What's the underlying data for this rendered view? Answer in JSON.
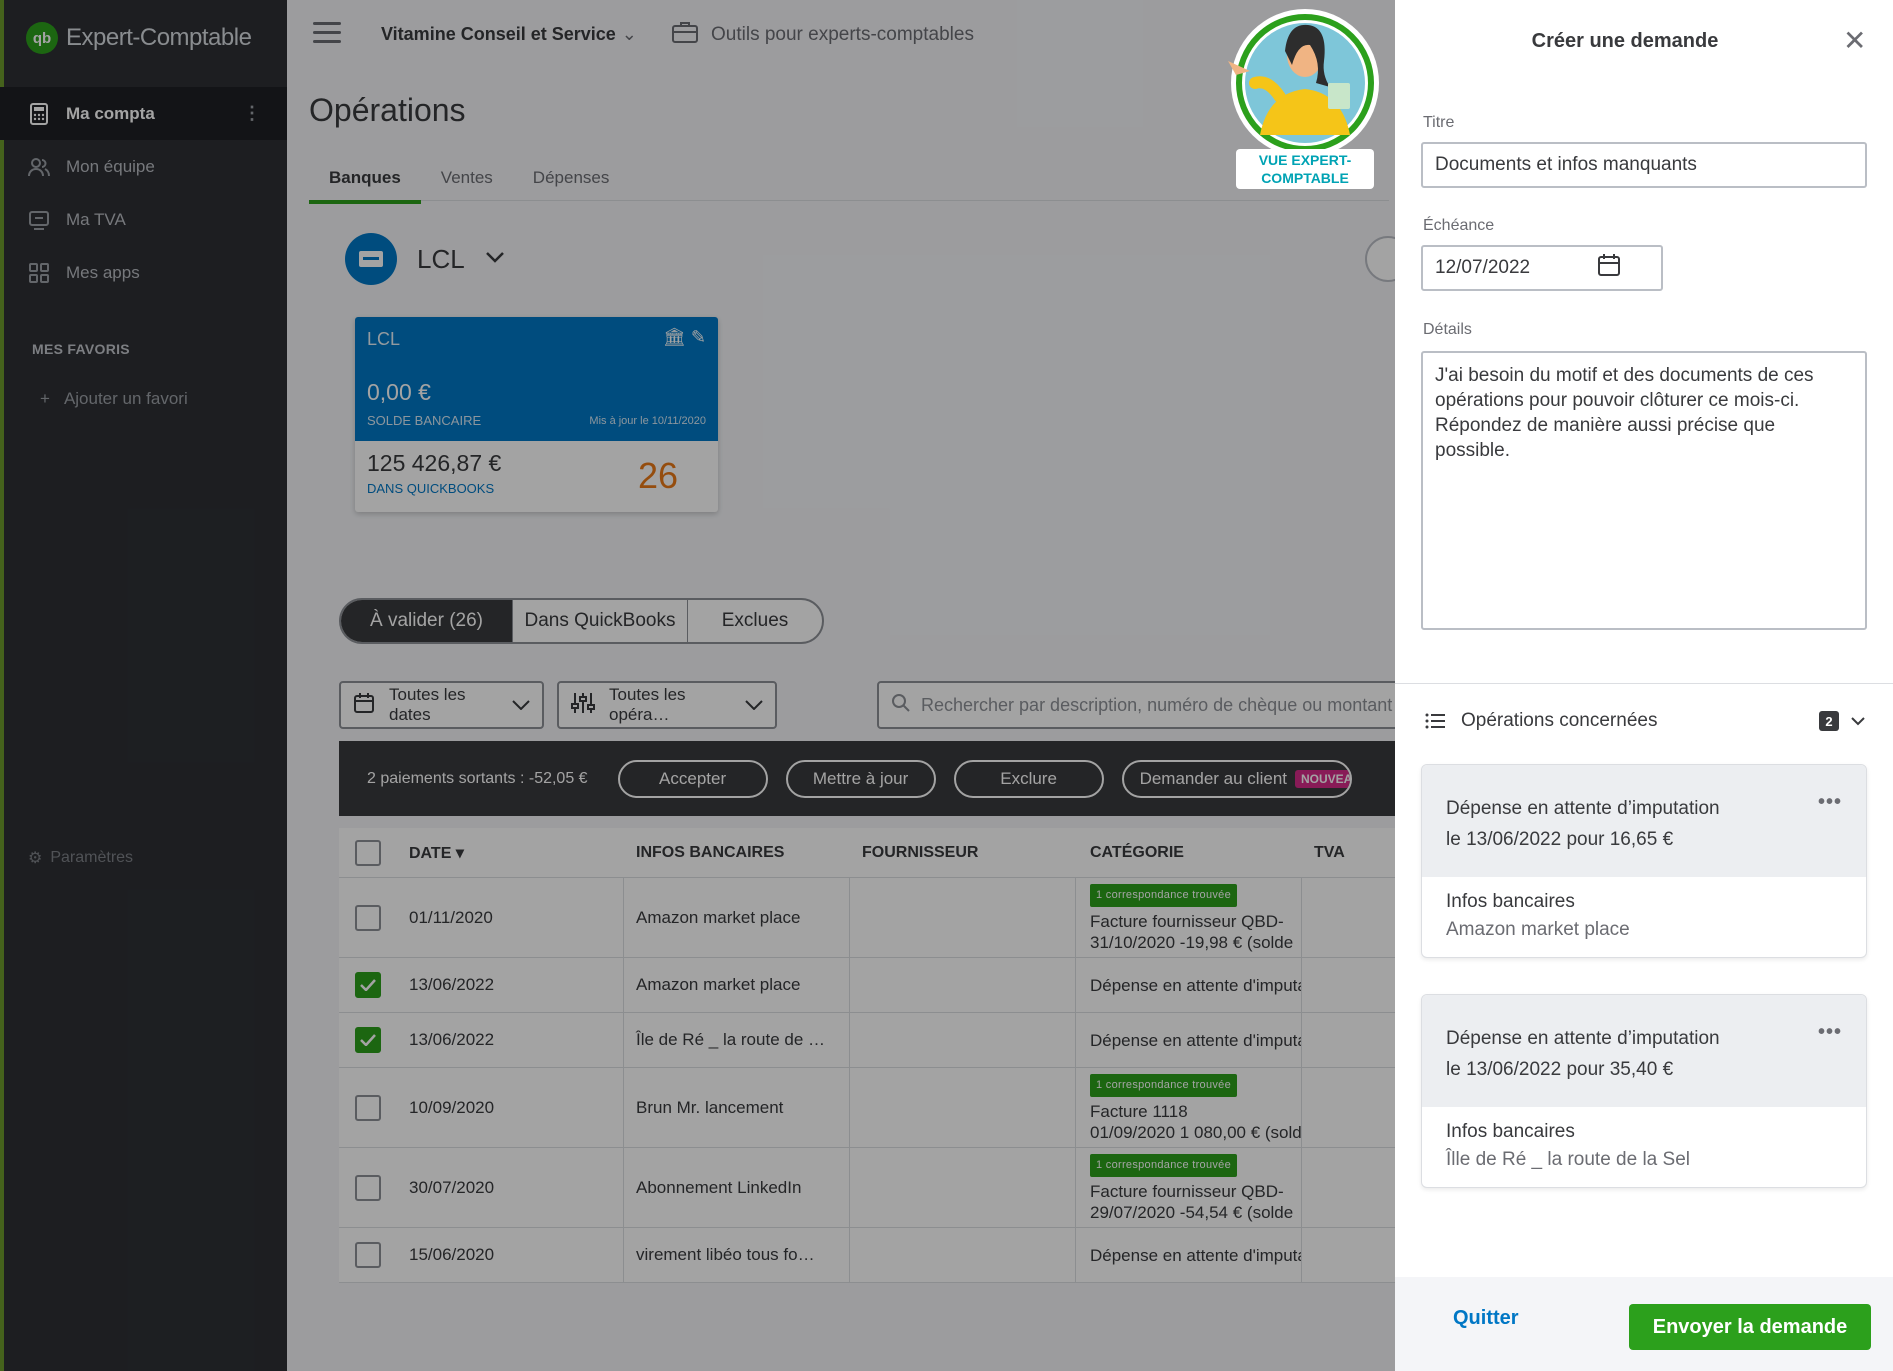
{
  "app": {
    "brand": "Expert-Comptable",
    "logo": "qb"
  },
  "sidebar": {
    "items": [
      {
        "label": "Ma compta",
        "icon": "calculator-icon"
      },
      {
        "label": "Mon équipe",
        "icon": "team-icon"
      },
      {
        "label": "Ma TVA",
        "icon": "tax-icon"
      },
      {
        "label": "Mes apps",
        "icon": "apps-icon"
      }
    ],
    "favorites_title": "MES FAVORIS",
    "add_favorite": "Ajouter un favori",
    "settings": "Paramètres"
  },
  "topbar": {
    "company": "Vitamine Conseil et Service",
    "tools": "Outils pour experts-comptables"
  },
  "page": {
    "title": "Opérations",
    "tabs": [
      "Banques",
      "Ventes",
      "Dépenses"
    ]
  },
  "bank": {
    "selected": "LCL",
    "card": {
      "name": "LCL",
      "balance": "0,00 €",
      "balance_label": "SOLDE BANCAIRE",
      "updated": "Mis à jour le 10/11/2020",
      "qb_balance": "125 426,87 €",
      "qb_label": "DANS QUICKBOOKS",
      "pending": "26"
    }
  },
  "segments": [
    "À valider (26)",
    "Dans QuickBooks",
    "Exclues"
  ],
  "filters": {
    "dates": "Toutes les dates",
    "operations": "Toutes les opéra…",
    "search_placeholder": "Rechercher par description, numéro de chèque ou montant"
  },
  "bulk": {
    "summary": "2 paiements sortants : -52,05 €",
    "accept": "Accepter",
    "update": "Mettre à jour",
    "exclude": "Exclure",
    "ask_client": "Demander au client",
    "new_badge": "NOUVEAU"
  },
  "table": {
    "headers": [
      "DATE",
      "INFOS BANCAIRES",
      "FOURNISSEUR",
      "CATÉGORIE",
      "TVA"
    ],
    "rows": [
      {
        "checked": false,
        "date": "01/11/2020",
        "bank": "Amazon market place",
        "match": "1 correspondance trouvée",
        "cat1": "Facture fournisseur QBD-",
        "cat2": "31/10/2020 -19,98 € (solde"
      },
      {
        "checked": true,
        "date": "13/06/2022",
        "bank": "Amazon market place",
        "match": "",
        "cat1": "Dépense en attente d'imputation",
        "cat2": ""
      },
      {
        "checked": true,
        "date": "13/06/2022",
        "bank": "Île de Ré _ la route de …",
        "match": "",
        "cat1": "Dépense en attente d'imputation",
        "cat2": ""
      },
      {
        "checked": false,
        "date": "10/09/2020",
        "bank": "Brun Mr. lancement",
        "match": "1 correspondance trouvée",
        "cat1": "Facture 1118",
        "cat2": "01/09/2020 1 080,00 € (solde"
      },
      {
        "checked": false,
        "date": "30/07/2020",
        "bank": "Abonnement LinkedIn",
        "match": "1 correspondance trouvée",
        "cat1": "Facture fournisseur QBD-",
        "cat2": "29/07/2020 -54,54 € (solde"
      },
      {
        "checked": false,
        "date": "15/06/2020",
        "bank": "virement libéo tous fo…",
        "match": "",
        "cat1": "Dépense en attente d'imputation",
        "cat2": ""
      }
    ]
  },
  "badge": {
    "line1": "VUE EXPERT-",
    "line2": "COMPTABLE"
  },
  "panel": {
    "title": "Créer une demande",
    "title_label": "Titre",
    "title_value": "Documents et infos manquants",
    "due_label": "Échéance",
    "due_value": "12/07/2022",
    "details_label": "Détails",
    "details_value": "J'ai besoin du motif et des documents de ces opérations pour pouvoir clôturer ce mois-ci. Répondez de manière aussi précise que possible.",
    "ops_title": "Opérations concernées",
    "ops_count": "2",
    "ops": [
      {
        "line1": "Dépense en attente d’imputation",
        "line2": "le 13/06/2022 pour 16,65 €",
        "info_title": "Infos bancaires",
        "info_value": "Amazon market place"
      },
      {
        "line1": "Dépense en attente d’imputation",
        "line2": "le 13/06/2022 pour 35,40 €",
        "info_title": "Infos bancaires",
        "info_value": "Îlle de Ré _ la route de la Sel"
      }
    ],
    "quit": "Quitter",
    "send": "Envoyer la demande"
  },
  "colors": {
    "brand_green": "#2ca01c",
    "blue": "#0077c5",
    "orange": "#e97917",
    "sidebar_bg": "#2e3035"
  }
}
